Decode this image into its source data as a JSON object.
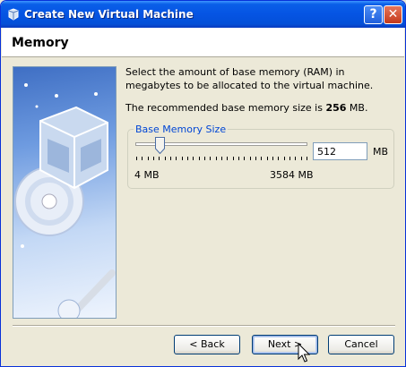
{
  "window": {
    "title": "Create New Virtual Machine"
  },
  "titlebar": {
    "help_label": "?",
    "close_label": "✕"
  },
  "page": {
    "title": "Memory"
  },
  "content": {
    "intro": "Select the amount of base memory (RAM) in megabytes to be allocated to the virtual machine.",
    "recommended_prefix": "The recommended base memory size is ",
    "recommended_value": "256",
    "recommended_suffix": " MB."
  },
  "memory": {
    "group_label": "Base Memory Size",
    "value": "512",
    "unit": "MB",
    "min_label": "4 MB",
    "max_label": "3584 MB",
    "slider_fraction": 0.143
  },
  "buttons": {
    "back": "< Back",
    "next": "Next >",
    "cancel": "Cancel"
  },
  "icons": {
    "app": "virtualbox-icon",
    "banner": "virtualbox-cube-illustration",
    "help": "help-icon",
    "close": "close-icon",
    "cursor": "mouse-pointer-icon"
  },
  "colors": {
    "titlebar": "#0554e3",
    "dialog_bg": "#ece9d8",
    "group_label": "#0046d5",
    "close_button": "#c4391b"
  }
}
